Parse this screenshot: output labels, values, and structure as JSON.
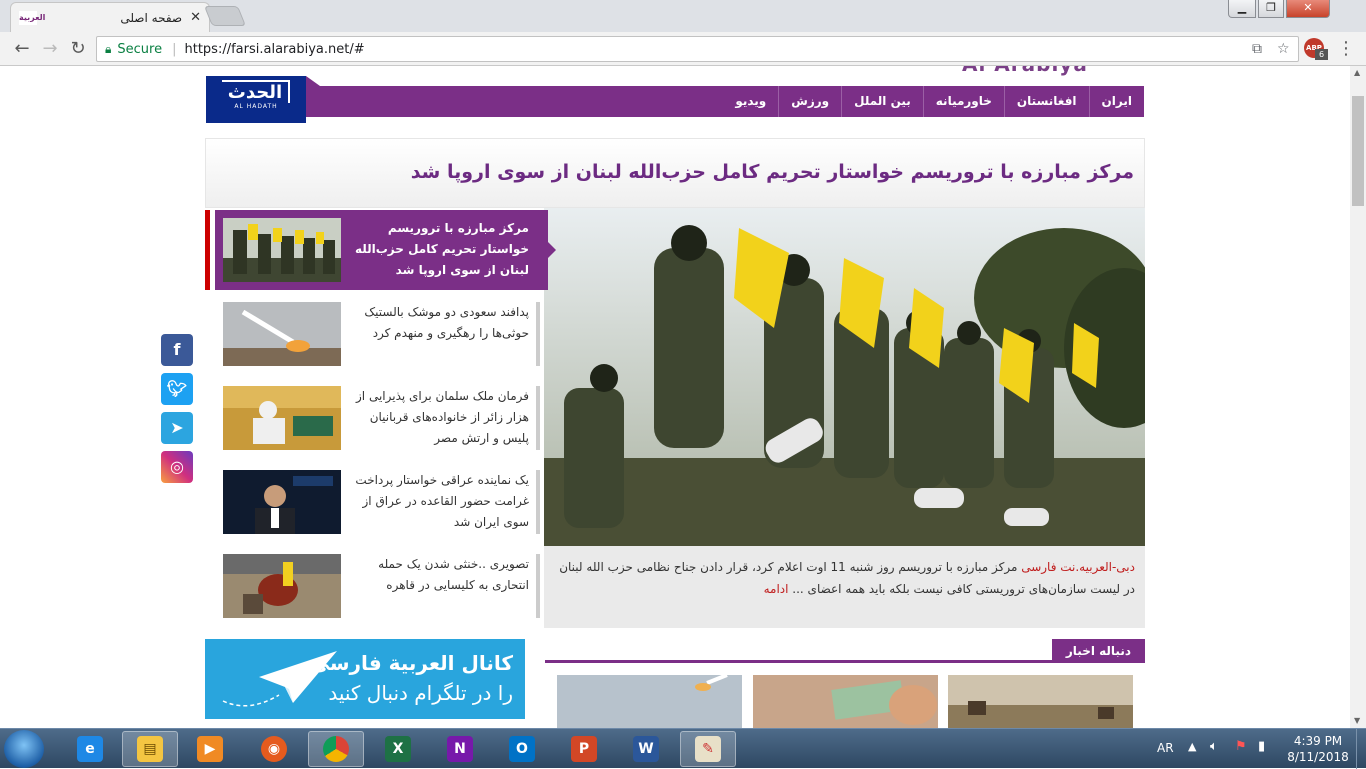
{
  "browser": {
    "tab_title": "صفحه اصلی",
    "tab_favicon_text": "العربية",
    "omnibox": {
      "secure_label": "Secure",
      "url": "https://farsi.alarabiya.net/#"
    },
    "extension_abp": {
      "label": "ABP",
      "count": "6"
    }
  },
  "site": {
    "top_logo_text": "Al Arabiya",
    "hadath_logo": {
      "arabic": "الحدث",
      "english": "AL HADATH"
    },
    "nav_items": [
      "ایران",
      "افغانستان",
      "خاورمیانه",
      "بین الملل",
      "ورزش",
      "ویدیو"
    ],
    "headline": "مرکز مبارزه با تروریسم خواستار تحریم کامل حزب‌الله لبنان از سوی اروپا شد",
    "caption": {
      "source": "دبی-العربیه.نت فارسی",
      "text": " مرکز مبارزه با تروریسم روز شنبه 11 اوت اعلام کرد، قرار دادن جناح نظامی حزب الله لبنان در لیست سازمان‌های تروریستی کافی نیست بلکه باید همه اعضای ...",
      "more": "ادامه"
    },
    "stories": [
      {
        "text": "مرکز مبارزه با تروریسم خواستار تحریم کامل حزب‌الله لبنان از سوی اروپا شد",
        "active": true
      },
      {
        "text": "پدافند سعودی دو موشک بالستیک حوثی‌ها را رهگیری و منهدم کرد",
        "active": false
      },
      {
        "text": "فرمان ملک سلمان برای پذیرایی از هزار زائر از خانواده‌های قربانیان پلیس و ارتش مصر",
        "active": false
      },
      {
        "text": "یک نماینده عراقی خواستار پرداخت غرامت حضور القاعده در عراق از سوی ایران شد",
        "active": false
      },
      {
        "text": "تصویری ..خنثی شدن یک حمله انتحاری به کلیسایی در قاهره",
        "active": false
      }
    ],
    "telegram_ad": {
      "line1": "کانال العربية فارسی",
      "line2": "را در تلگرام دنبال کنید"
    },
    "follow_news_label": "دنباله اخبار",
    "social": [
      "f",
      "t",
      "tg",
      "ig"
    ]
  },
  "taskbar": {
    "apps": [
      "ie-icon",
      "explorer-icon",
      "media-player-icon",
      "firefox-icon",
      "chrome-icon",
      "excel-icon",
      "onenote-icon",
      "outlook-icon",
      "powerpoint-icon",
      "word-icon",
      "paint-icon"
    ],
    "language": "AR",
    "time": "4:39 PM",
    "date": "8/11/2018"
  }
}
